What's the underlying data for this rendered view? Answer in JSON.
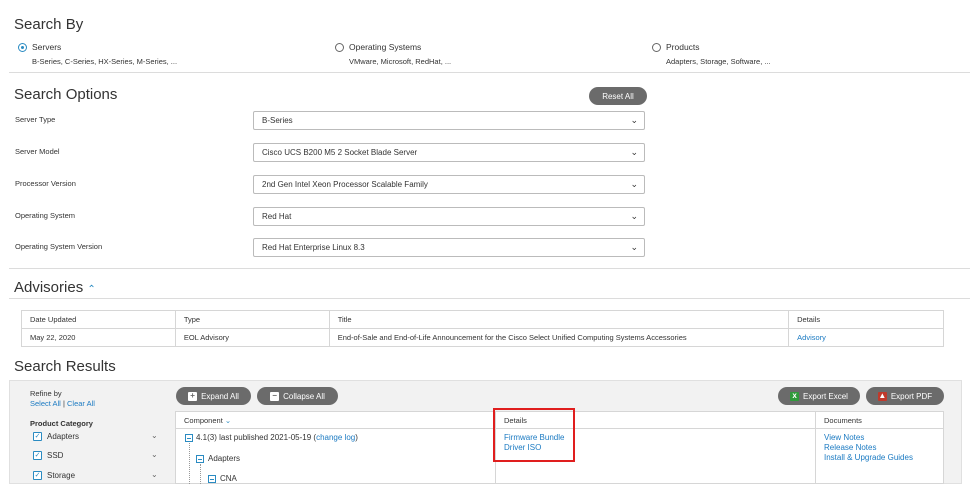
{
  "search_by": {
    "title": "Search By",
    "options": [
      {
        "label": "Servers",
        "sub": "B-Series, C-Series, HX-Series, M-Series, ...",
        "selected": true
      },
      {
        "label": "Operating Systems",
        "sub": "VMware, Microsoft, RedHat, ...",
        "selected": false
      },
      {
        "label": "Products",
        "sub": "Adapters, Storage, Software, ...",
        "selected": false
      }
    ]
  },
  "search_options": {
    "title": "Search Options",
    "reset_label": "Reset All",
    "fields": [
      {
        "label": "Server Type",
        "value": "B-Series"
      },
      {
        "label": "Server Model",
        "value": "Cisco UCS B200 M5 2 Socket Blade Server"
      },
      {
        "label": "Processor Version",
        "value": "2nd Gen Intel Xeon Processor Scalable Family"
      },
      {
        "label": "Operating System",
        "value": "Red Hat"
      },
      {
        "label": "Operating System Version",
        "value": "Red Hat Enterprise Linux 8.3"
      }
    ]
  },
  "advisories": {
    "title": "Advisories",
    "columns": [
      "Date Updated",
      "Type",
      "Title",
      "Details"
    ],
    "rows": [
      {
        "date": "May 22, 2020",
        "type": "EOL Advisory",
        "title": "End-of-Sale and End-of-Life Announcement for the Cisco Select Unified Computing Systems Accessories",
        "details": "Advisory"
      }
    ]
  },
  "search_results": {
    "title": "Search Results",
    "refine_by": "Refine by",
    "select_all": "Select All",
    "separator": "|",
    "clear_all": "Clear All",
    "product_category": "Product Category",
    "categories": [
      "Adapters",
      "SSD",
      "Storage"
    ],
    "expand_all": "Expand All",
    "collapse_all": "Collapse All",
    "export_excel": "Export Excel",
    "export_pdf": "Export PDF",
    "columns": {
      "component": "Component",
      "details": "Details",
      "documents": "Documents"
    },
    "release": {
      "prefix": "4.1(3) last published 2021-05-19 (",
      "link": "change log",
      "suffix": ")"
    },
    "tree": [
      "Adapters",
      "CNA"
    ],
    "details_links": [
      "Firmware Bundle",
      "Driver ISO"
    ],
    "document_links": [
      "View Notes",
      "Release Notes",
      "Install & Upgrade Guides"
    ]
  },
  "colors": {
    "accent": "#2a8bc2",
    "link": "#1b7ac2",
    "highlight": "#e01e1e",
    "button": "#6b6b6b"
  }
}
